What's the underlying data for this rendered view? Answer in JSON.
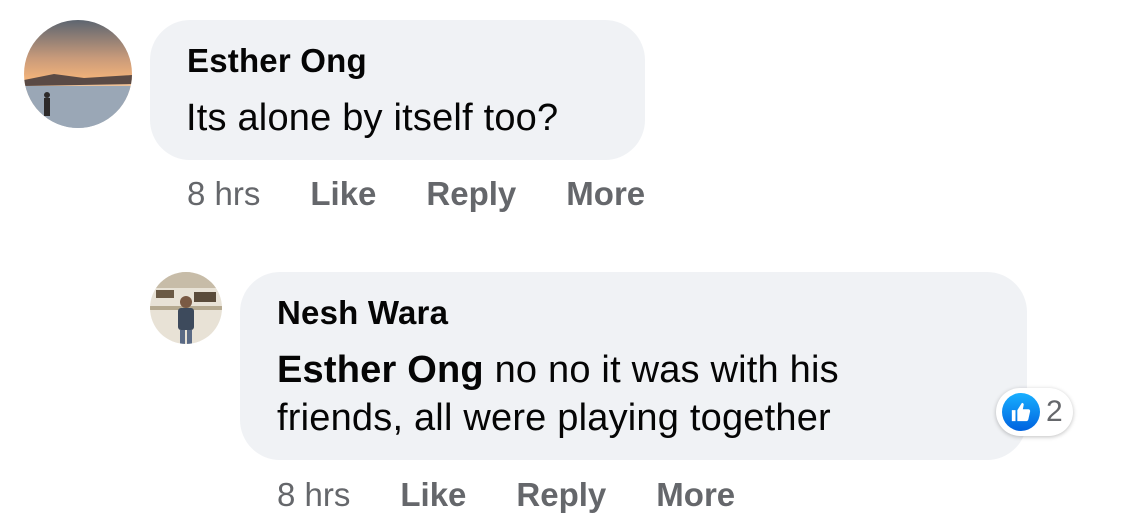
{
  "comments": [
    {
      "author": "Esther Ong",
      "text": "Its alone by itself too?",
      "actions": {
        "time": "8 hrs",
        "like": "Like",
        "reply": "Reply",
        "more": "More"
      }
    },
    {
      "author": "Nesh Wara",
      "mention": "Esther Ong",
      "text": " no no it was with his friends, all were playing together",
      "reaction": {
        "icon": "like-thumb-icon",
        "count": "2"
      },
      "actions": {
        "time": "8 hrs",
        "like": "Like",
        "reply": "Reply",
        "more": "More"
      }
    }
  ],
  "colors": {
    "bubble": "#f0f2f5",
    "secondary_text": "#65676b",
    "like_blue": "#1877f2"
  }
}
